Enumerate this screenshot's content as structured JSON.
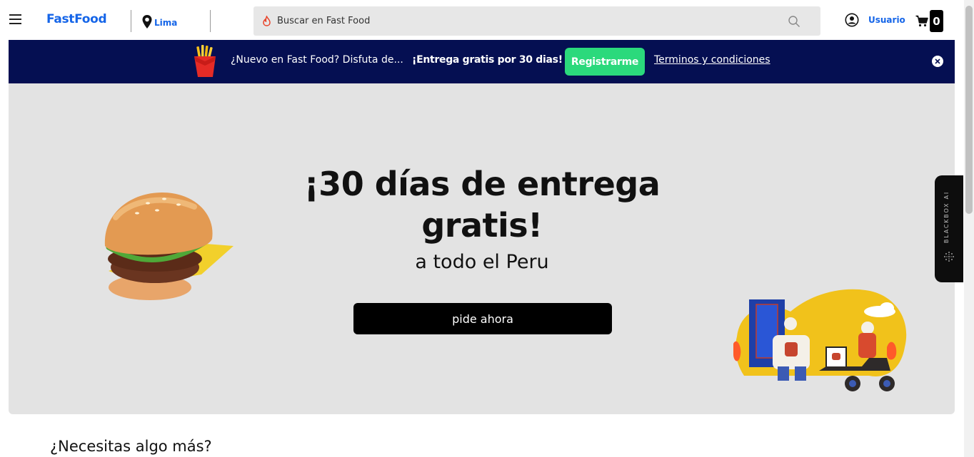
{
  "header": {
    "brand": "FastFood",
    "location": "Lima",
    "search_placeholder": "Buscar en Fast Food",
    "user_label": "Usuario",
    "cart_count": "0"
  },
  "promo": {
    "text": "¿Nuevo en Fast Food? Disfuta de...",
    "highlight": "¡Entrega gratis por 30 dias!",
    "register_label": "Registrarme",
    "terms_label": "Terminos y condiciones"
  },
  "hero": {
    "title": "¡30 días de entrega gratis!",
    "subtitle": "a todo el Peru",
    "cta_label": "pide ahora"
  },
  "widget": {
    "label": "BLACKBOX AI"
  },
  "section": {
    "title": "¿Necesitas algo más?"
  },
  "colors": {
    "brand_blue": "#1565e8",
    "banner_navy": "#050f52",
    "register_green": "#2bd97c",
    "hero_bg": "#e3e3e3"
  },
  "icons": [
    "menu-icon",
    "location-pin-icon",
    "flame-icon",
    "search-icon",
    "user-icon",
    "cart-icon",
    "close-icon"
  ]
}
